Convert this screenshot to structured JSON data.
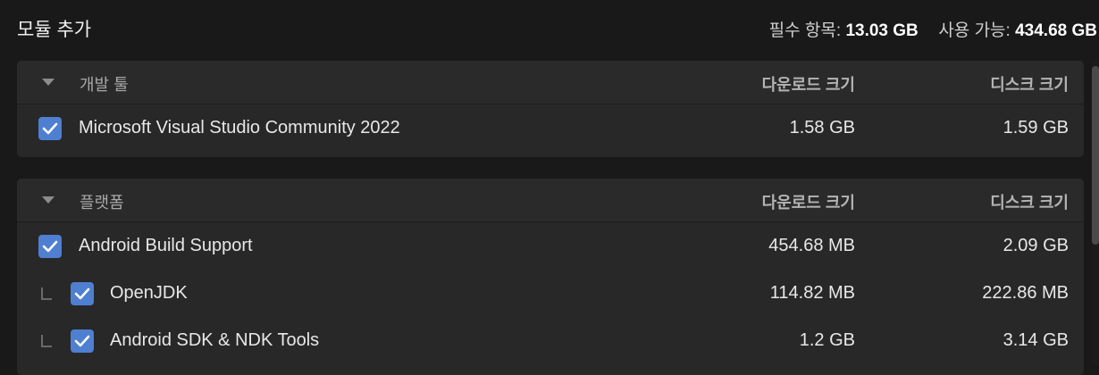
{
  "header": {
    "title": "모듈 추가",
    "required_label": "필수 항목:",
    "required_value": "13.03 GB",
    "available_label": "사용 가능:",
    "available_value": "434.68 GB"
  },
  "columns": {
    "download_size": "다운로드 크기",
    "disk_size": "디스크 크기"
  },
  "sections": [
    {
      "title": "개발 툴",
      "items": [
        {
          "label": "Microsoft Visual Studio Community 2022",
          "download": "1.58 GB",
          "disk": "1.59 GB",
          "checked": true
        }
      ]
    },
    {
      "title": "플랫폼",
      "items": [
        {
          "label": "Android Build Support",
          "download": "454.68 MB",
          "disk": "2.09 GB",
          "checked": true
        },
        {
          "label": "OpenJDK",
          "download": "114.82 MB",
          "disk": "222.86 MB",
          "checked": true
        },
        {
          "label": "Android SDK & NDK Tools",
          "download": "1.2 GB",
          "disk": "3.14 GB",
          "checked": true
        }
      ]
    }
  ],
  "colors": {
    "background": "#191919",
    "panel": "#282828",
    "checkbox_accent": "#4f7fd0"
  }
}
